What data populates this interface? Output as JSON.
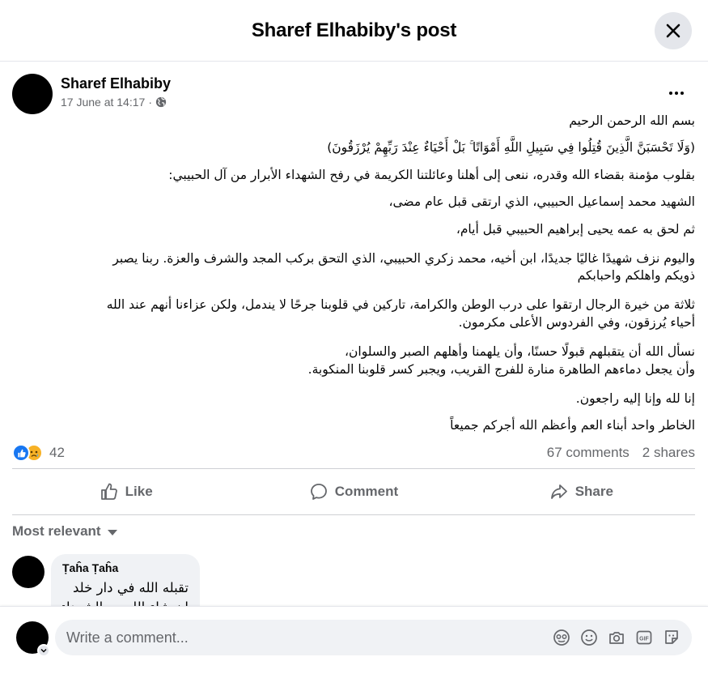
{
  "header": {
    "title": "Sharef Elhabiby's post",
    "close_icon": "close-icon"
  },
  "post": {
    "author": "Sharef Elhabiby",
    "date": "17 June at 14:17",
    "separator": "·",
    "audience_icon": "globe-icon",
    "more_icon": "more-icon",
    "lines": [
      "بسم الله الرحمن الرحيم",
      "(وَلَا تَحْسَبَنَّ الَّذِينَ قُتِلُوا فِي سَبِيلِ اللَّهِ أَمْوَاتًا ۚ بَلْ أَحْيَاءٌ عِنْدَ رَبِّهِمْ يُرْزَقُونَ)",
      "بقلوب مؤمنة بقضاء الله وقدره، ننعى إلى أهلنا وعائلتنا الكريمة في رفح الشهداء الأبرار من آل الحبيبي:",
      "الشهيد محمد إسماعيل الحبيبي، الذي ارتقى قبل عام مضى،",
      "ثم لحق به عمه يحيى إبراهيم الحبيبي قبل أيام،",
      "واليوم نزف شهيدًا غاليًا جديدًا، ابن أخيه، محمد زكري الحبيبي، الذي التحق بركب المجد والشرف والعزة. ربنا يصبر",
      "ذويكم واهلكم واحبابكم",
      "ثلاثة من خيرة الرجال ارتقوا على درب الوطن والكرامة، تاركين في قلوبنا جرحًا لا يندمل، ولكن عزاءنا أنهم عند الله",
      "أحياء يُرزقون، وفي الفردوس الأعلى مكرمون.",
      "نسأل الله أن يتقبلهم قبولًا حسنًا، وأن يلهمنا وأهلهم الصبر والسلوان،",
      "وأن يجعل دماءهم الطاهرة منارة للفرج القريب، ويجبر كسر قلوبنا المنكوبة.",
      "إنا لله وإنا إليه راجعون.",
      "الخاطر واحد أبناء العم وأعظم الله أجركم جميعاً"
    ]
  },
  "stats": {
    "reaction_icons": [
      "like-icon",
      "sad-icon"
    ],
    "reaction_count": "42",
    "comments": "67 comments",
    "shares": "2 shares"
  },
  "actions": {
    "like": "Like",
    "comment": "Comment",
    "share": "Share"
  },
  "comments_section": {
    "sort_label": "Most relevant",
    "comments": [
      {
        "name": "Ṭaĥa Ṭaĥa",
        "text": "تقبله الله في دار خلد",
        "text2": "ان شاء الله مع الشهداء"
      }
    ]
  },
  "composer": {
    "placeholder": "Write a comment...",
    "tools": [
      "avatar-sticker-icon",
      "emoji-icon",
      "camera-icon",
      "gif-icon",
      "sticker-icon"
    ]
  },
  "colors": {
    "accent": "#1877f2",
    "secondary_text": "#65676b",
    "surface": "#f0f2f5",
    "sad": "#f7b125"
  }
}
